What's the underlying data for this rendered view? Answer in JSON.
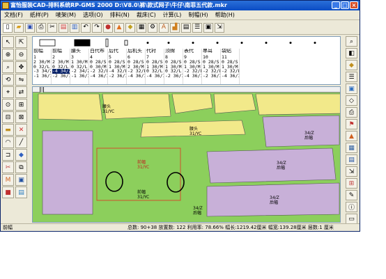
{
  "window": {
    "title": "富怡服装CAD-排料系统RP-GMS 2000 D:\\V8.0\\裤\\款式网子\\牛仔\\南菲五代款.mkr",
    "min_label": "_",
    "max_label": "□",
    "close_label": "×"
  },
  "menu": [
    "文档(F)",
    "纸样(P)",
    "唛架(M)",
    "选项(O)",
    "排料(N)",
    "裁床(C)",
    "计算(L)",
    "制帽(H)",
    "帮助(H)"
  ],
  "toolbar_icons": [
    "new-file-icon",
    "open-file-icon",
    "save-icon",
    "print-icon",
    "cut-icon",
    "copy-icon",
    "paste-icon",
    "undo-icon",
    "redo-icon",
    "zoom-icon",
    "color-icon",
    "pattern-icon",
    "grid-icon",
    "settings-icon",
    "text-icon",
    "ruler-icon",
    "table-icon",
    "list-icon",
    "layout-icon",
    "export-icon"
  ],
  "pieces": [
    {
      "name": "前幅",
      "size": "34/Z",
      "rows": [
        "2 30/M",
        "0 32/L",
        "-3 34/Z",
        "-1 36/I"
      ],
      "selected": false
    },
    {
      "name": "前幅",
      "size": "34/Z",
      "rows": [
        "2 30/M",
        "0 32/L",
        "-4 34/Z",
        "-2 36/I"
      ],
      "selected": true
    },
    {
      "name": "腰头",
      "size": "34/Z",
      "rows": [
        "1 30/M",
        "0 32/L",
        "-2 34/Z",
        "-1 36/I"
      ],
      "selected": false
    },
    {
      "name": "白代布",
      "size": "28/S",
      "rows": [
        "0 28/S",
        "0 30/M",
        "-2 32/L",
        "-4 36/I"
      ],
      "selected": false
    },
    {
      "name": "后代",
      "size": "28/S",
      "rows": [
        "0 28/S",
        "1 30/M",
        "-4 32/L",
        "-2 36/I"
      ],
      "selected": false
    },
    {
      "name": "后机头",
      "size": "28/S",
      "rows": [
        "0 28/S",
        "2 30/M",
        "-2 32/L",
        "-4 36/I"
      ],
      "selected": false
    },
    {
      "name": "代衬",
      "size": "28/S",
      "rows": [
        "0 28/S",
        "1 30/M",
        "0 32/L",
        "-4 36/I"
      ],
      "selected": false
    },
    {
      "name": "顶牌",
      "size": "28/S",
      "rows": [
        "0 28/S",
        "1 30/M",
        "0 32/L",
        "-2 36/I"
      ],
      "selected": false
    },
    {
      "name": "表代",
      "size": "28/S",
      "rows": [
        "0 28/S",
        "1 30/M",
        "-2 32/L",
        "-4 36/I"
      ],
      "selected": false
    },
    {
      "name": "串耳",
      "size": "28/S",
      "rows": [
        "0 28/S",
        "1 30/M",
        "-2 32/L",
        "-2 36/I"
      ],
      "selected": false
    },
    {
      "name": "袋贴",
      "size": "28/S",
      "rows": [
        "0 28/S",
        "1 30/M",
        "-2 32/L",
        "-4 36/I"
      ],
      "selected": false
    }
  ],
  "piece_numbers": [
    "1",
    "2",
    "3",
    "4",
    "5",
    "6",
    "7",
    "8",
    "9",
    "10",
    "11"
  ],
  "canvas_labels": {
    "top_piece": "腰头",
    "top_size": "31/YC",
    "yellow_mid": "腰头",
    "yellow_mid_size": "31/YC",
    "red_piece": "前幅",
    "red_size": "31/YC",
    "green_label": "前幅",
    "green_size": "31/YC",
    "purple_a": "34/Z",
    "purple_a_name": "后幅",
    "purple_b": "34/Z",
    "purple_b_name": "后幅",
    "purple_c": "34/Z",
    "purple_c_name": "后幅",
    "green_mid": "34/Z",
    "green_mid_name": "后幅"
  },
  "status": {
    "left": "前幅",
    "total_label": "总数: 90+38",
    "placed_label": "放置数: 122",
    "usage_label": "利用率: 78.66%",
    "length_label": "幅长:1219.42厘米",
    "width_label": "幅宽:139.28厘米",
    "layers_label": "层数:1",
    "unit_label": "厘米"
  },
  "colors": {
    "yellow_piece": "#f2e98a",
    "green_piece": "#8ccf5c",
    "purple_piece": "#c8b0d8",
    "red_outline": "#e03020",
    "annotation_circle": "#000000"
  }
}
